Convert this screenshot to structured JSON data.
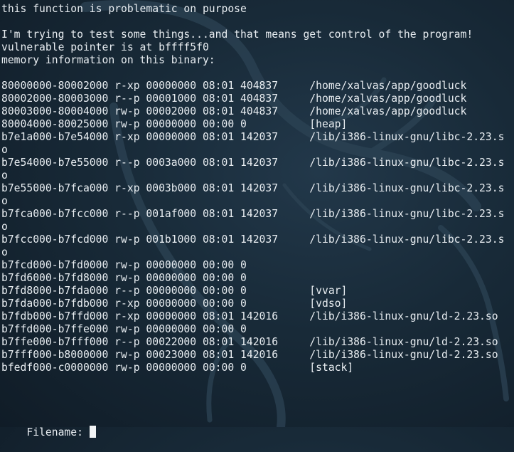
{
  "terminal": {
    "lines": [
      "this function is problematic on purpose",
      "",
      "I'm trying to test some things...and that means get control of the program!",
      "vulnerable pointer is at bffff5f0",
      "memory information on this binary:",
      "",
      "80000000-80002000 r-xp 00000000 08:01 404837     /home/xalvas/app/goodluck",
      "80002000-80003000 r--p 00001000 08:01 404837     /home/xalvas/app/goodluck",
      "80003000-80004000 rw-p 00002000 08:01 404837     /home/xalvas/app/goodluck",
      "80004000-80025000 rw-p 00000000 00:00 0          [heap]",
      "b7e1a000-b7e54000 r-xp 00000000 08:01 142037     /lib/i386-linux-gnu/libc-2.23.s",
      "o",
      "b7e54000-b7e55000 r--p 0003a000 08:01 142037     /lib/i386-linux-gnu/libc-2.23.s",
      "o",
      "b7e55000-b7fca000 r-xp 0003b000 08:01 142037     /lib/i386-linux-gnu/libc-2.23.s",
      "o",
      "b7fca000-b7fcc000 r--p 001af000 08:01 142037     /lib/i386-linux-gnu/libc-2.23.s",
      "o",
      "b7fcc000-b7fcd000 rw-p 001b1000 08:01 142037     /lib/i386-linux-gnu/libc-2.23.s",
      "o",
      "b7fcd000-b7fd0000 rw-p 00000000 00:00 0",
      "b7fd6000-b7fd8000 rw-p 00000000 00:00 0",
      "b7fd8000-b7fda000 r--p 00000000 00:00 0          [vvar]",
      "b7fda000-b7fdb000 r-xp 00000000 00:00 0          [vdso]",
      "b7fdb000-b7ffd000 r-xp 00000000 08:01 142016     /lib/i386-linux-gnu/ld-2.23.so",
      "b7ffd000-b7ffe000 rw-p 00000000 00:00 0",
      "b7ffe000-b7fff000 r--p 00022000 08:01 142016     /lib/i386-linux-gnu/ld-2.23.so",
      "b7fff000-b8000000 rw-p 00023000 08:01 142016     /lib/i386-linux-gnu/ld-2.23.so",
      "bfedf000-c0000000 rw-p 00000000 00:00 0          [stack]"
    ],
    "prompt": {
      "label": "Filename: ",
      "value": ""
    }
  },
  "colors": {
    "background": "#182a38",
    "text": "#e8edf1",
    "cursor": "#f2f4f6"
  },
  "icons": {
    "background": "dragon-watermark-icon"
  }
}
